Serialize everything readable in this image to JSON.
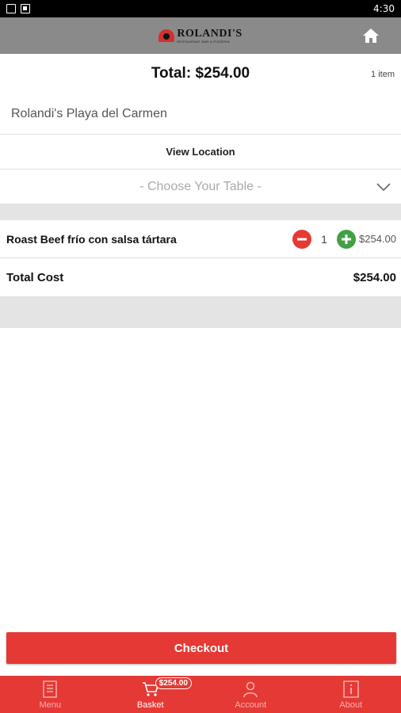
{
  "status_bar": {
    "time": "4:30"
  },
  "header": {
    "logo_text": "ROLANDI'S",
    "logo_subtext": "RESTAURANT BAR & PIZZERIA"
  },
  "summary": {
    "total": "Total: $254.00",
    "item_count": "1 item"
  },
  "location": {
    "name": "Rolandi's Playa del Carmen",
    "view_label": "View Location"
  },
  "table_select": {
    "placeholder": "- Choose Your Table -"
  },
  "cart": {
    "items": [
      {
        "name": "Roast Beef frío con salsa tártara",
        "quantity": "1",
        "price": "$254.00"
      }
    ],
    "total_label": "Total Cost",
    "total_value": "$254.00"
  },
  "checkout": {
    "label": "Checkout"
  },
  "bottom_nav": {
    "items": [
      {
        "label": "Menu",
        "icon": "menu-book-icon"
      },
      {
        "label": "Basket",
        "icon": "cart-icon",
        "badge": "$254.00"
      },
      {
        "label": "Account",
        "icon": "person-icon"
      },
      {
        "label": "About",
        "icon": "info-icon"
      }
    ]
  },
  "colors": {
    "accent": "#e53935",
    "app_bar": "#8a8a8a",
    "plus": "#43a047"
  }
}
